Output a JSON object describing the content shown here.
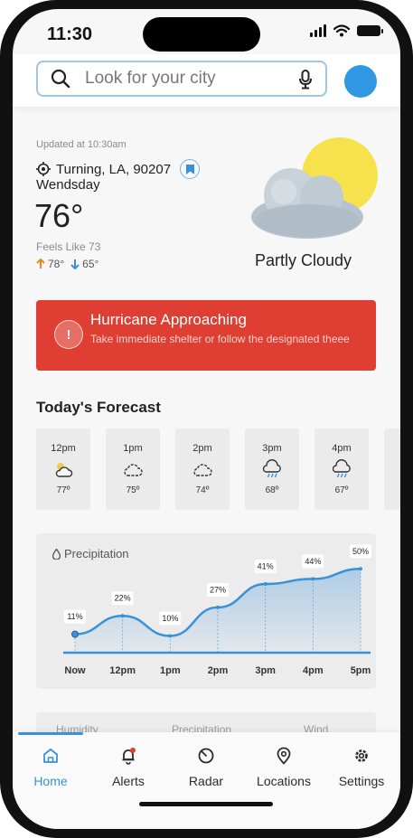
{
  "status_bar": {
    "time": "11:30"
  },
  "search": {
    "placeholder": "Look for your city"
  },
  "current": {
    "updated": "Updated at 10:30am",
    "location": "Turning, LA, 90207",
    "day": "Wendsday",
    "temperature": "76°",
    "feels_like": "Feels Like 73",
    "high": "78°",
    "low": "65°",
    "condition": "Partly Cloudy"
  },
  "alert": {
    "title": "Hurricane Approaching",
    "message": "Take immediate shelter or follow the designated theee",
    "color": "#df3e32"
  },
  "forecast": {
    "title": "Today's Forecast",
    "hours": [
      {
        "time": "12pm",
        "icon": "sun-cloud-icon",
        "temp": "77º"
      },
      {
        "time": "1pm",
        "icon": "cloud-icon",
        "temp": "75º"
      },
      {
        "time": "2pm",
        "icon": "cloud-icon",
        "temp": "74º"
      },
      {
        "time": "3pm",
        "icon": "rain-cloud-icon",
        "temp": "68º"
      },
      {
        "time": "4pm",
        "icon": "rain-cloud-icon",
        "temp": "67º"
      }
    ]
  },
  "chart_data": {
    "type": "area",
    "title": "Precipitation",
    "x": [
      "Now",
      "12pm",
      "1pm",
      "2pm",
      "3pm",
      "4pm",
      "5pm"
    ],
    "values": [
      11,
      22,
      10,
      27,
      41,
      44,
      50
    ],
    "labels": [
      "11%",
      "22%",
      "10%",
      "27%",
      "41%",
      "44%",
      "50%"
    ],
    "ylim": [
      0,
      55
    ],
    "color": "#3b91d8"
  },
  "detail_tabs": [
    "Humidity",
    "Precipitation",
    "Wind"
  ],
  "nav": {
    "items": [
      {
        "label": "Home",
        "icon": "home-icon",
        "active": true
      },
      {
        "label": "Alerts",
        "icon": "bell-icon",
        "active": false
      },
      {
        "label": "Radar",
        "icon": "radar-icon",
        "active": false
      },
      {
        "label": "Locations",
        "icon": "location-pin-icon",
        "active": false
      },
      {
        "label": "Settings",
        "icon": "gear-icon",
        "active": false
      }
    ]
  },
  "colors": {
    "accent": "#3b91d8",
    "sun": "#f6e24d",
    "alert": "#df3e32"
  }
}
